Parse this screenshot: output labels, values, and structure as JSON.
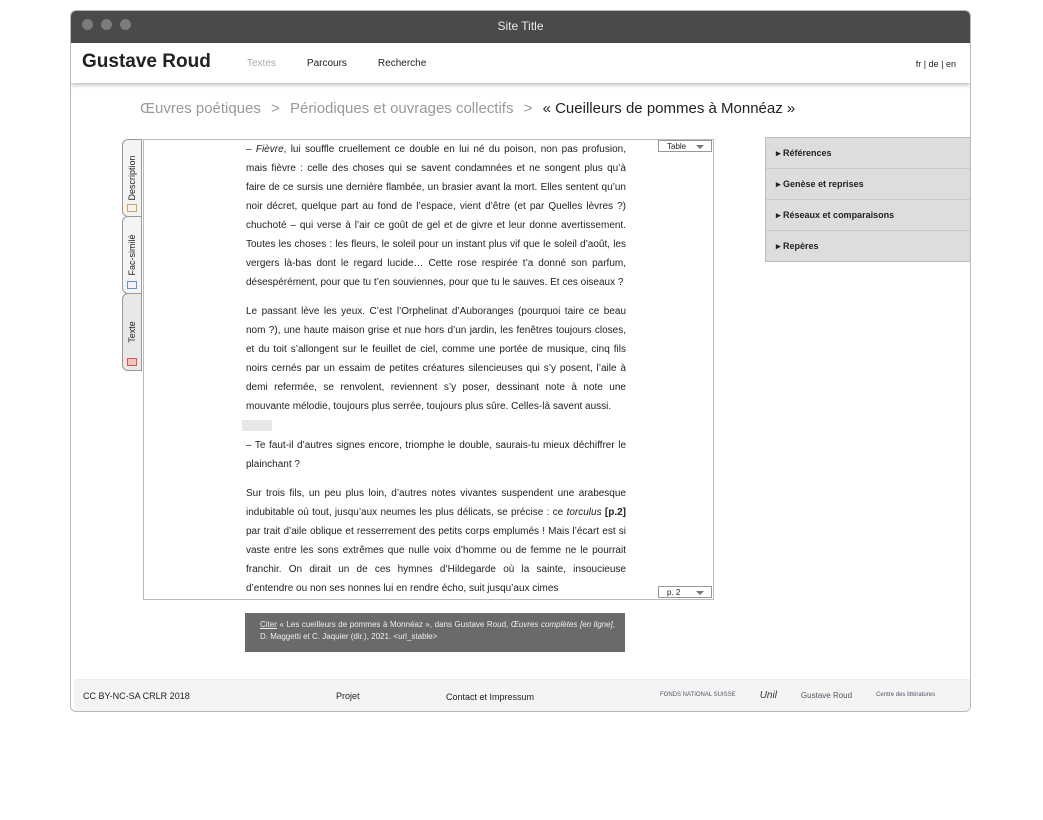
{
  "window": {
    "title": "Site Title"
  },
  "header": {
    "site_name": "Gustave Roud",
    "nav": [
      "Textes",
      "Parcours",
      "Recherche"
    ],
    "langs": "fr | de | en"
  },
  "breadcrumb": {
    "items": [
      "Œuvres poétiques",
      "Périodiques et ouvrages collectifs"
    ],
    "current": "« Cueilleurs de pommes à Monnéaz »",
    "separator": ">"
  },
  "tabs": [
    "Description",
    "Fac-similé",
    "Texte"
  ],
  "panel": {
    "table_select": "Table",
    "page_select": "p. 2",
    "p1_italic": "Fièvre",
    "p1_rest": ", lui souffle cruellement ce double en lui né du poison, non pas profusion, mais fièvre : celle des choses qui se savent condamnées et ne songent plus qu’à faire de ce sursis une dernière flambée, un brasier avant la mort. Elles sentent qu’un noir décret, quelque part au fond de l’espace, vient d’être (et par Quelles lèvres ?) chuchoté – qui verse à l’air ce goût de gel et de givre et leur donne avertissement. Toutes les choses : les fleurs, le soleil pour un instant plus vif que le soleil d’août, les vergers là-bas dont le regard lucide… Cette rose respirée t’a donné son parfum, désespérément, pour que tu t’en souviennes, pour que tu le sauves. Et ces oiseaux ?",
    "p2": "Le passant lève les yeux. C’est l’Orphelinat d’Auboranges (pourquoi taire ce beau nom ?), une haute maison grise et nue hors d’un jardin, les fenêtres toujours closes, et du toit s’allongent sur le feuillet de ciel, comme une portée de musique, cinq fils noirs cernés par un essaim de petites créatures silencieuses qui s’y posent, l’aile à demi refermée, se renvolent, reviennent s’y poser, dessinant note à note une mouvante mélodie, toujours plus serrée, toujours plus sûre. Celles-là savent aussi.",
    "p3": "– Te faut-il d’autres signes encore, triomphe le double, saurais-tu mieux déchiffrer le plainchant ?",
    "p4_a": "Sur trois fils, un peu plus loin, d’autres notes vivantes suspendent une arabesque indubitable où tout, jusqu’aux neumes les plus délicats, se précise : ce ",
    "p4_italic": "torculus",
    "p4_mark": "[p.2]",
    "p4_b": " par trait d’aile oblique et resserrement des petits corps emplumés ! Mais l’écart est si vaste entre les sons extrêmes que nulle voix d’homme ou de femme ne le pourrait franchir. On dirait un de ces hymnes d’Hildegarde où la sainte, insoucieuse d’entendre ou non ses nonnes lui en rendre écho, suit jusqu’aux cimes"
  },
  "citation": {
    "link": "Citer",
    "text_a": " « Les cueilleurs de pommes à Monnéaz », dans Gustave Roud, ",
    "text_italic": "Œuvres complètes [en ligne]",
    "text_b": ", D. Maggetti et C. Jaquier (dir.), 2021. <url_stable>"
  },
  "sidebar": [
    "Références",
    "Genèse et reprises",
    "Réseaux et comparaisons",
    "Repères"
  ],
  "footer": {
    "license": "CC BY-NC-SA CRLR 2018",
    "project": "Projet",
    "contact": "Contact et Impressum",
    "logos": [
      "FONDS NATIONAL SUISSE",
      "Unil",
      "Gustave Roud",
      "Centre des littératures"
    ]
  }
}
